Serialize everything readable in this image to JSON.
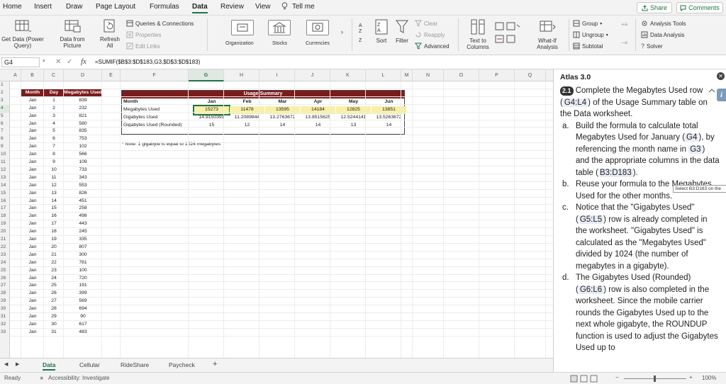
{
  "ribbon_tabs": [
    "Home",
    "Insert",
    "Draw",
    "Page Layout",
    "Formulas",
    "Data",
    "Review",
    "View",
    "Tell me"
  ],
  "share_label": "Share",
  "comments_label": "Comments",
  "ribbon": {
    "get_data": [
      "Get Data (Power",
      "Query)"
    ],
    "data_from_picture": [
      "Data from",
      "Picture"
    ],
    "refresh_all": [
      "Refresh",
      "All"
    ],
    "queries_connections": "Queries & Connections",
    "properties": "Properties",
    "edit_links": "Edit Links",
    "organization": "Organization",
    "stocks": "Stocks",
    "currencies": "Currencies",
    "sort": "Sort",
    "filter": "Filter",
    "clear": "Clear",
    "reapply": "Reapply",
    "advanced": "Advanced",
    "text_to_columns": [
      "Text to",
      "Columns"
    ],
    "what_if": [
      "What-If",
      "Analysis"
    ],
    "group": "Group",
    "ungroup": "Ungroup",
    "subtotal": "Subtotal",
    "analysis_tools": "Analysis Tools",
    "data_analysis": "Data Analysis",
    "solver": "Solver"
  },
  "formula_bar": {
    "name_box": "G4",
    "fx": "fx",
    "formula": "=SUMIF($B$3:$D$183,G3,$D$3:$D$183)"
  },
  "columns": [
    "A",
    "B",
    "C",
    "D",
    "E",
    "F",
    "G",
    "H",
    "I",
    "J",
    "K",
    "L",
    "M",
    "N",
    "O",
    "P",
    "Q"
  ],
  "rows": [
    "1",
    "2",
    "3",
    "4",
    "5",
    "6",
    "7",
    "8",
    "9",
    "10",
    "11",
    "12",
    "13",
    "14",
    "15",
    "16",
    "17",
    "18",
    "19",
    "20",
    "21",
    "22",
    "23",
    "24",
    "25",
    "26",
    "27",
    "28",
    "29",
    "30",
    "31",
    "32",
    "33"
  ],
  "data_table": {
    "headers": [
      "Month",
      "Day",
      "Megabytes Used"
    ],
    "rows": [
      [
        "Jan",
        "1",
        "839"
      ],
      [
        "Jan",
        "2",
        "232"
      ],
      [
        "Jan",
        "3",
        "821"
      ],
      [
        "Jan",
        "4",
        "580"
      ],
      [
        "Jan",
        "5",
        "835"
      ],
      [
        "Jan",
        "6",
        "753"
      ],
      [
        "Jan",
        "7",
        "102"
      ],
      [
        "Jan",
        "8",
        "566"
      ],
      [
        "Jan",
        "9",
        "109"
      ],
      [
        "Jan",
        "10",
        "733"
      ],
      [
        "Jan",
        "11",
        "343"
      ],
      [
        "Jan",
        "12",
        "553"
      ],
      [
        "Jan",
        "13",
        "826"
      ],
      [
        "Jan",
        "14",
        "451"
      ],
      [
        "Jan",
        "15",
        "258"
      ],
      [
        "Jan",
        "16",
        "498"
      ],
      [
        "Jan",
        "17",
        "443"
      ],
      [
        "Jan",
        "18",
        "245"
      ],
      [
        "Jan",
        "19",
        "335"
      ],
      [
        "Jan",
        "20",
        "807"
      ],
      [
        "Jan",
        "21",
        "300"
      ],
      [
        "Jan",
        "22",
        "781"
      ],
      [
        "Jan",
        "23",
        "100"
      ],
      [
        "Jan",
        "24",
        "720"
      ],
      [
        "Jan",
        "25",
        "191"
      ],
      [
        "Jan",
        "26",
        "399"
      ],
      [
        "Jan",
        "27",
        "569"
      ],
      [
        "Jan",
        "28",
        "694"
      ],
      [
        "Jan",
        "29",
        "90"
      ],
      [
        "Jan",
        "30",
        "617"
      ],
      [
        "Jan",
        "31",
        "483"
      ]
    ]
  },
  "summary": {
    "title": "Usage Summary",
    "months": [
      "Month",
      "Jan",
      "Feb",
      "Mar",
      "Apr",
      "May",
      "Jun"
    ],
    "megabytes": [
      "Megabytes Used",
      "15273",
      "11478",
      "13595",
      "14184",
      "12825",
      "13851"
    ],
    "gigabytes": [
      "Gigabytes Used",
      "14.9150391",
      "11.2089844",
      "13.2763672",
      "13.8515625",
      "12.5244141",
      "13.5263672"
    ],
    "gigabytes_rounded": [
      "Gigabytes Used (Rounded)",
      "15",
      "12",
      "14",
      "14",
      "13",
      "14"
    ]
  },
  "note": "* Note: 1 gigabyte is equal to 1024 megabytes",
  "sheet_tabs": [
    "Data",
    "Cellular",
    "RideShare",
    "Paycheck",
    "+"
  ],
  "status": {
    "ready": "Ready",
    "accessibility": "Accessibility: Investigate",
    "zoom": "100%"
  },
  "panel": {
    "title": "Atlas 3.0",
    "step": "2.1",
    "intro_a": " Complete the Megabytes Used row (",
    "intro_ref": "G4:L4",
    "intro_b": ") of the Usage Summary table on the Data worksheet.",
    "a_letter": "a.",
    "a_1": "Build the formula to calculate total Megabytes Used for January (",
    "a_ref1": "G4",
    "a_2": "), by referencing the month name in ",
    "a_ref2": "G3",
    "a_3": ") and the appropriate columns in the data table (",
    "a_ref3": "B3:D183",
    "a_4": ").",
    "b_letter": "b.",
    "b_1": "Reuse your formula to",
    "b_2": " the Megabytes Used for the other months.",
    "c_letter": "c.",
    "c_1": "Notice that the \"Gigabytes Used\" (",
    "c_ref": "G5:L5",
    "c_2": ") row is already completed in the worksheet. \"Gigabytes Used\" is calculated as the \"Megabytes Used\" divided by 1024 (the number of megabytes in a gigabyte).",
    "d_letter": "d.",
    "d_1": "The Gigabytes Used (Rounded) (",
    "d_ref": "G6:L6",
    "d_2": ") row is also completed in the worksheet. Since the mobile carrier rounds the Gigabytes Used up to the next whole gigabyte, the ROUNDUP function is used to adjust the Gigabytes Used up to",
    "tooltip": "Select B3:D183 on the"
  }
}
